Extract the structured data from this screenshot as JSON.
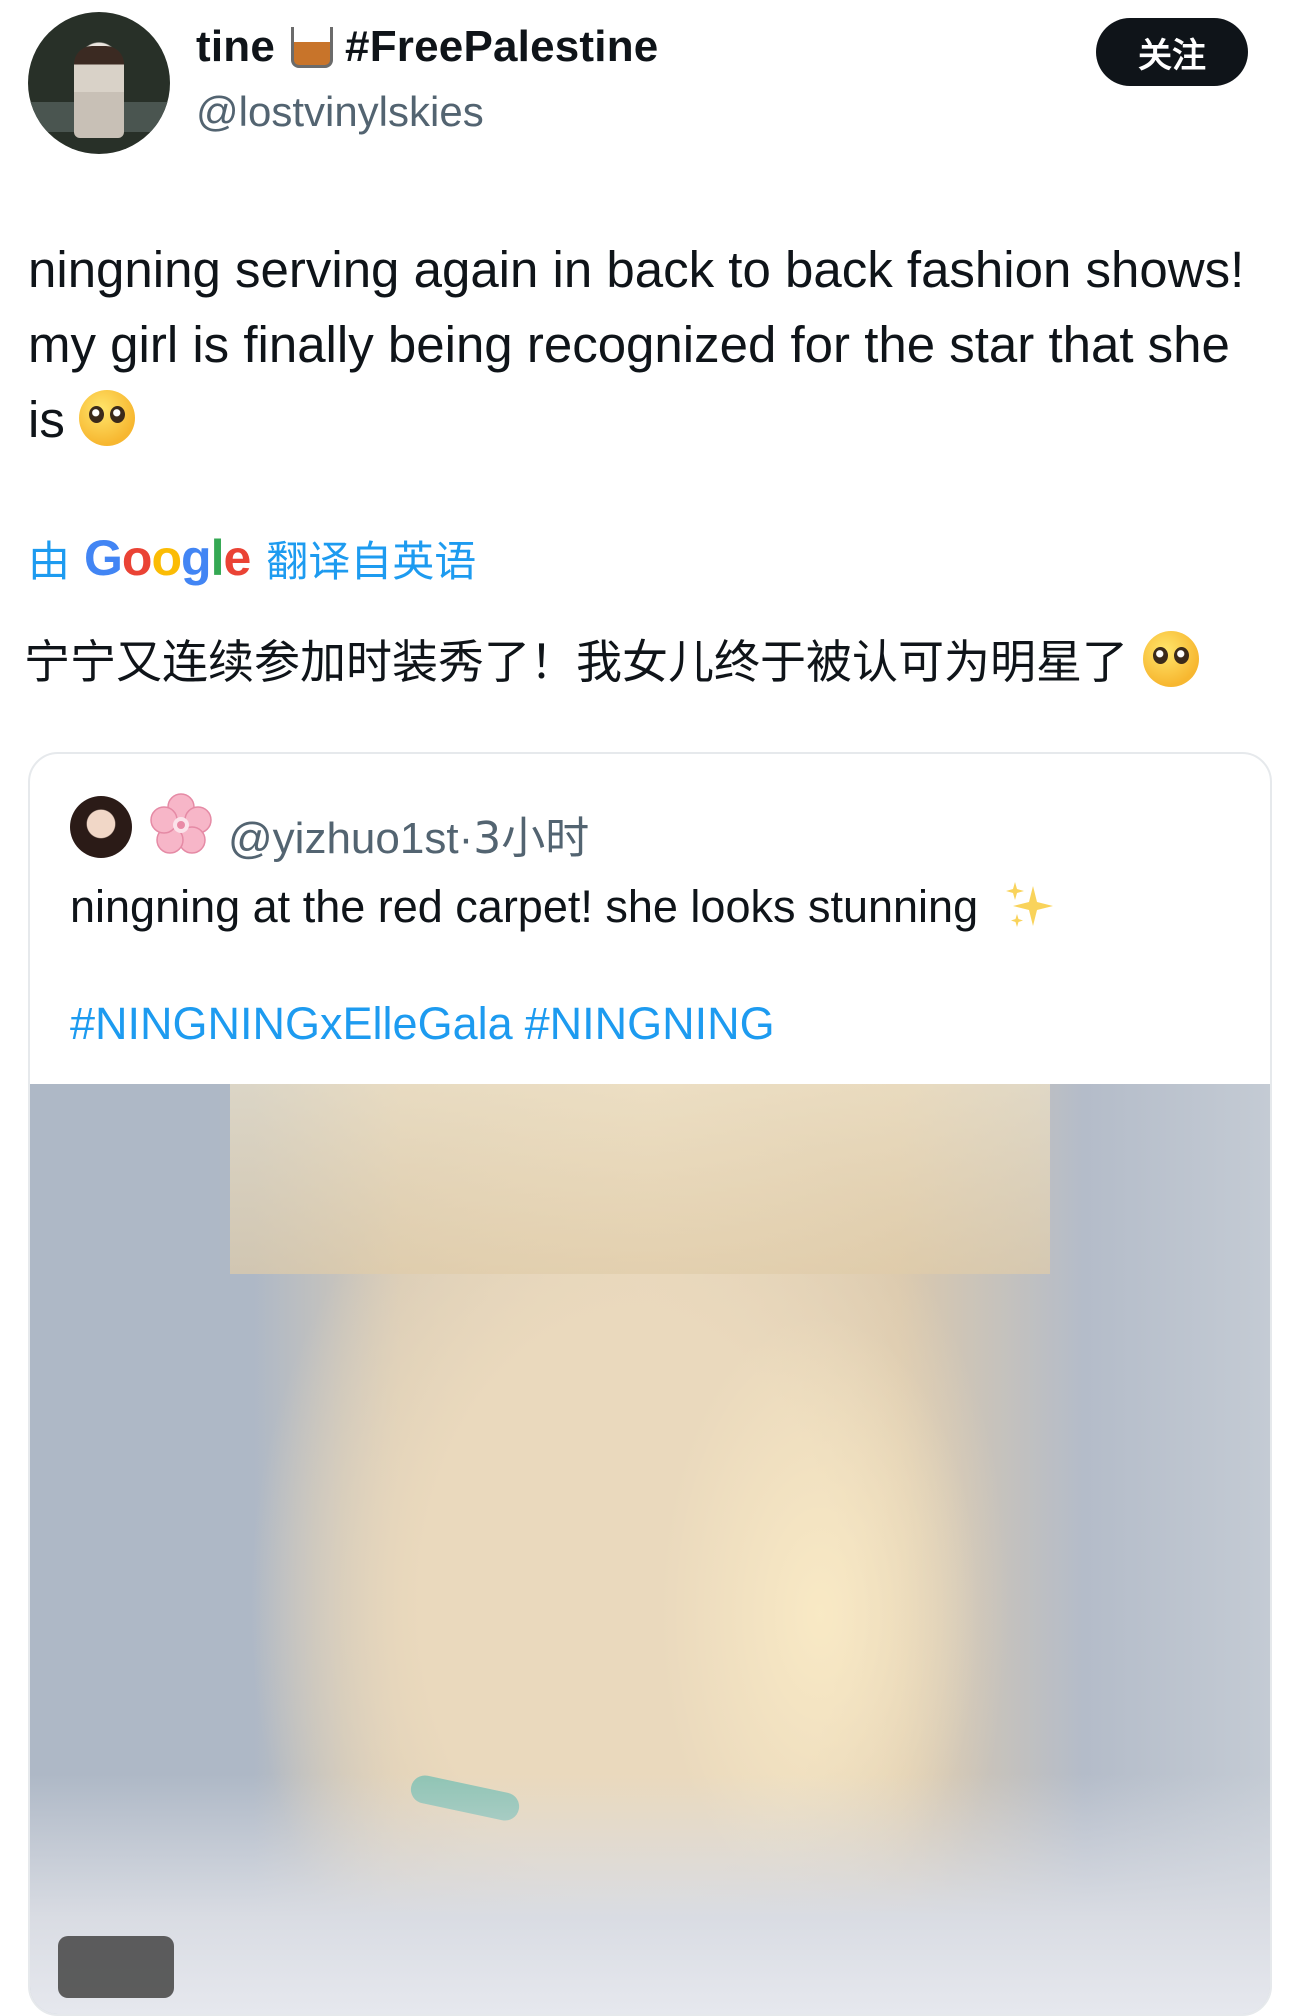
{
  "author": {
    "display_name": "tine",
    "display_name_emoji": "tumbler-glass-icon",
    "display_name_suffix": "#FreePalestine",
    "username": "@lostvinylskies"
  },
  "follow_button": {
    "label": "关注",
    "bg_color": "#0f1419",
    "text_color": "#ffffff"
  },
  "tweet": {
    "text": "ningning serving again in back to back fashion shows! my girl is finally being recognized for the star that she is",
    "trailing_emoji": "pleading-face-emoji"
  },
  "translation": {
    "prefix": "由",
    "provider": "Google",
    "suffix": "翻译自英语",
    "text": "宁宁又连续参加时装秀了！我女儿终于被认可为明星了",
    "link_color": "#1d9bf0"
  },
  "quoted_tweet": {
    "author_emoji": "cherry-blossom-icon",
    "handle": "@yizhuo1st",
    "separator": "·",
    "time": "3小时",
    "text": "ningning at the red carpet! she looks stunning",
    "text_emoji": "sparkles-icon",
    "hashtags": [
      "#NINGNINGxElleGala",
      "#NINGNING"
    ],
    "hashtag_color": "#1d9bf0",
    "media": "photo"
  }
}
